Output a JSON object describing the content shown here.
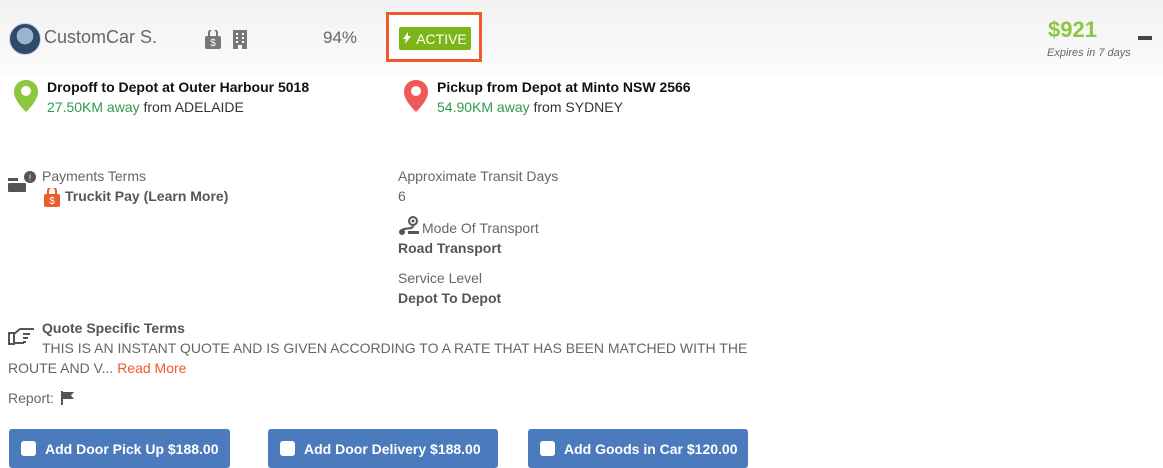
{
  "header": {
    "company_name": "CustomCar S.",
    "percent": "94%",
    "status": "ACTIVE",
    "price": "$921",
    "expires": "Expires in 7 days"
  },
  "dropoff": {
    "title": "Dropoff to Depot at Outer Harbour 5018",
    "distance": "27.50KM away",
    "from_prefix": " from ",
    "from_city": "ADELAIDE"
  },
  "pickup": {
    "title": "Pickup from Depot at Minto NSW 2566",
    "distance": "54.90KM away",
    "from_prefix": " from ",
    "from_city": "SYDNEY"
  },
  "payments": {
    "label": "Payments Terms",
    "value": "Truckit Pay (Learn More)"
  },
  "transit": {
    "label": "Approximate Transit Days",
    "value": "6"
  },
  "mode": {
    "label": "Mode Of Transport",
    "value": "Road Transport"
  },
  "service": {
    "label": "Service Level",
    "value": "Depot To Depot"
  },
  "quote_terms": {
    "title": "Quote Specific Terms",
    "line1": "THIS IS AN INSTANT QUOTE AND IS GIVEN ACCORDING TO A RATE THAT HAS BEEN MATCHED WITH THE",
    "line2": "ROUTE AND V... ",
    "read_more": "Read More"
  },
  "report": {
    "label": "Report:"
  },
  "addons": [
    {
      "label": "Add Door Pick Up $188.00"
    },
    {
      "label": "Add Door Delivery $188.00"
    },
    {
      "label": "Add Goods in Car $120.00"
    }
  ],
  "colors": {
    "accent_green": "#7cb518",
    "price_green": "#8dc63f",
    "highlight_orange": "#ee5a2c",
    "button_blue": "#4b7bbd"
  }
}
